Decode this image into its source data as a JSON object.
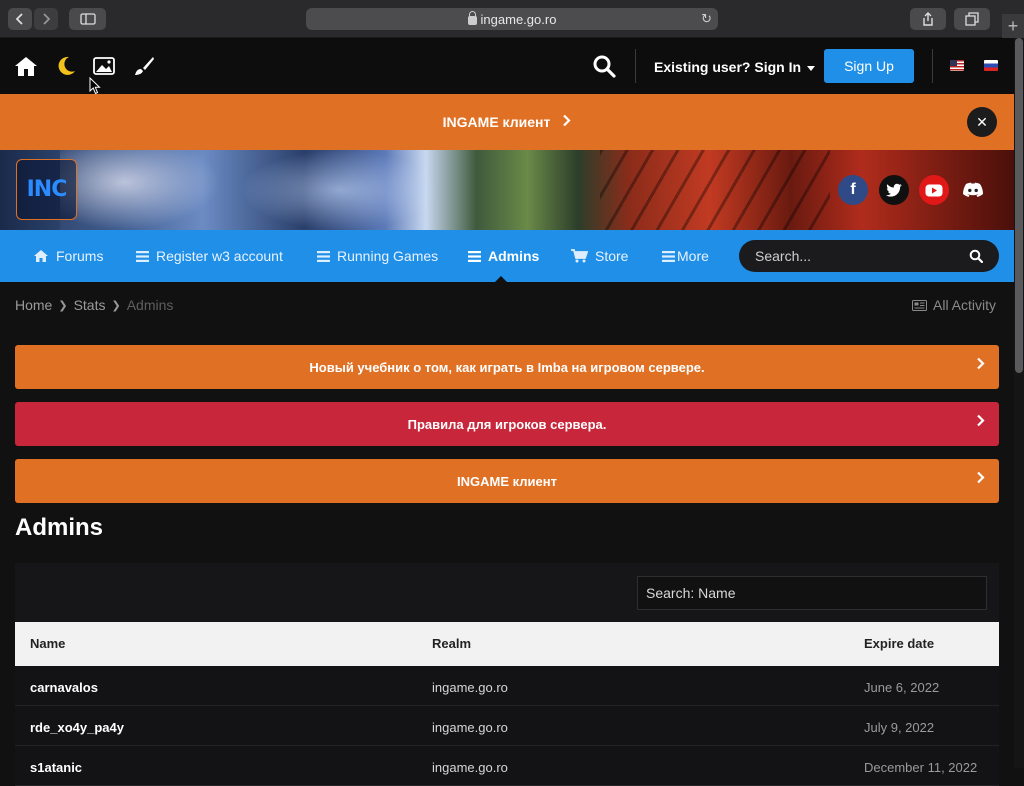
{
  "browser": {
    "url": "ingame.go.ro"
  },
  "userbar": {
    "signin_label": "Existing user? Sign In",
    "signup_label": "Sign Up"
  },
  "announcement": {
    "text": "INGAME клиент"
  },
  "logo_text": "INC",
  "nav": {
    "items": [
      {
        "label": "Forums",
        "icon": "home-icon"
      },
      {
        "label": "Register w3 account",
        "icon": "menu-icon"
      },
      {
        "label": "Running Games",
        "icon": "menu-icon"
      },
      {
        "label": "Admins",
        "icon": "menu-icon",
        "active": true
      },
      {
        "label": "Store",
        "icon": "cart-icon"
      },
      {
        "label": "More",
        "icon": "menu-icon"
      }
    ],
    "search_placeholder": "Search..."
  },
  "breadcrumb": {
    "items": [
      "Home",
      "Stats",
      "Admins"
    ],
    "all_activity": "All Activity"
  },
  "notices": [
    {
      "text": "Новый учебник о том, как играть в Imba на игровом сервере.",
      "color": "#e07024"
    },
    {
      "text": "Правила для игроков сервера.",
      "color": "#c8263a"
    },
    {
      "text": "INGAME клиент",
      "color": "#e07024"
    }
  ],
  "page_title": "Admins",
  "table": {
    "search_placeholder": "Search: Name",
    "columns": [
      "Name",
      "Realm",
      "Expire date"
    ],
    "rows": [
      {
        "name": "carnavalos",
        "realm": "ingame.go.ro",
        "expire": "June 6, 2022"
      },
      {
        "name": "rde_xo4y_pa4y",
        "realm": "ingame.go.ro",
        "expire": "July 9, 2022"
      },
      {
        "name": "s1atanic",
        "realm": "ingame.go.ro",
        "expire": "December 11, 2022"
      }
    ]
  },
  "colors": {
    "accent_blue": "#1f8fe8",
    "accent_orange": "#e07024",
    "accent_red": "#c8263a",
    "background": "#111112"
  }
}
